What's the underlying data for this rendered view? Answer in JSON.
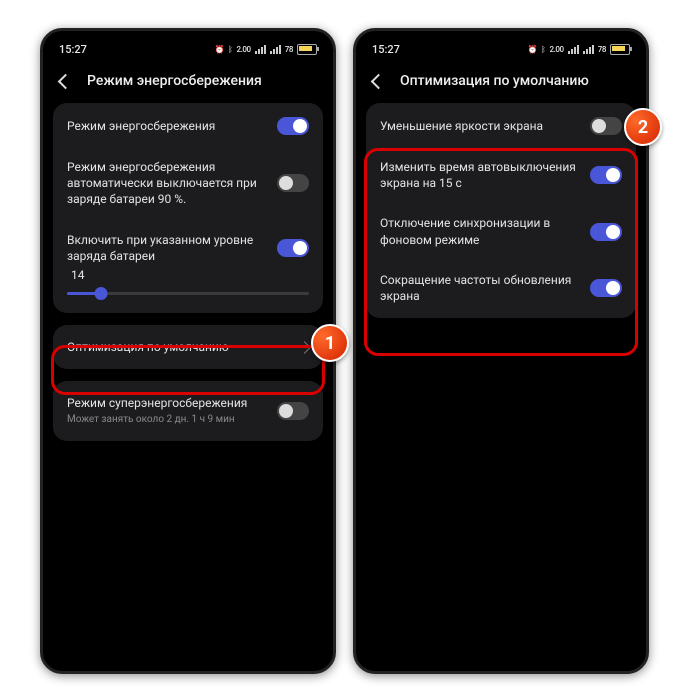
{
  "status": {
    "time": "15:27",
    "net": "2.00",
    "batt_pct": "78"
  },
  "screen1": {
    "title": "Режим энергосбережения",
    "card1": {
      "r1_label": "Режим энергосбережения",
      "r1_on": true,
      "r2_label": "Режим энергосбережения автоматически выключается при заряде батареи 90 %.",
      "r2_on": false,
      "r3_label": "Включить при указанном уровне заряда батареи",
      "r3_on": true,
      "slider_value": "14"
    },
    "card2": {
      "label": "Оптимизация по умолчанию"
    },
    "card3": {
      "label": "Режим суперэнергосбережения",
      "sub": "Может занять около 2 дн. 1 ч 9 мин",
      "on": false
    }
  },
  "screen2": {
    "title": "Оптимизация по умолчанию",
    "rows": [
      {
        "label": "Уменьшение яркости экрана",
        "on": false
      },
      {
        "label": "Изменить время автовыключения экрана на 15 с",
        "on": true
      },
      {
        "label": "Отключение синхронизации в фоновом режиме",
        "on": true
      },
      {
        "label": "Сокращение частоты обновления экрана",
        "on": true
      }
    ]
  },
  "badges": {
    "b1": "1",
    "b2": "2"
  }
}
